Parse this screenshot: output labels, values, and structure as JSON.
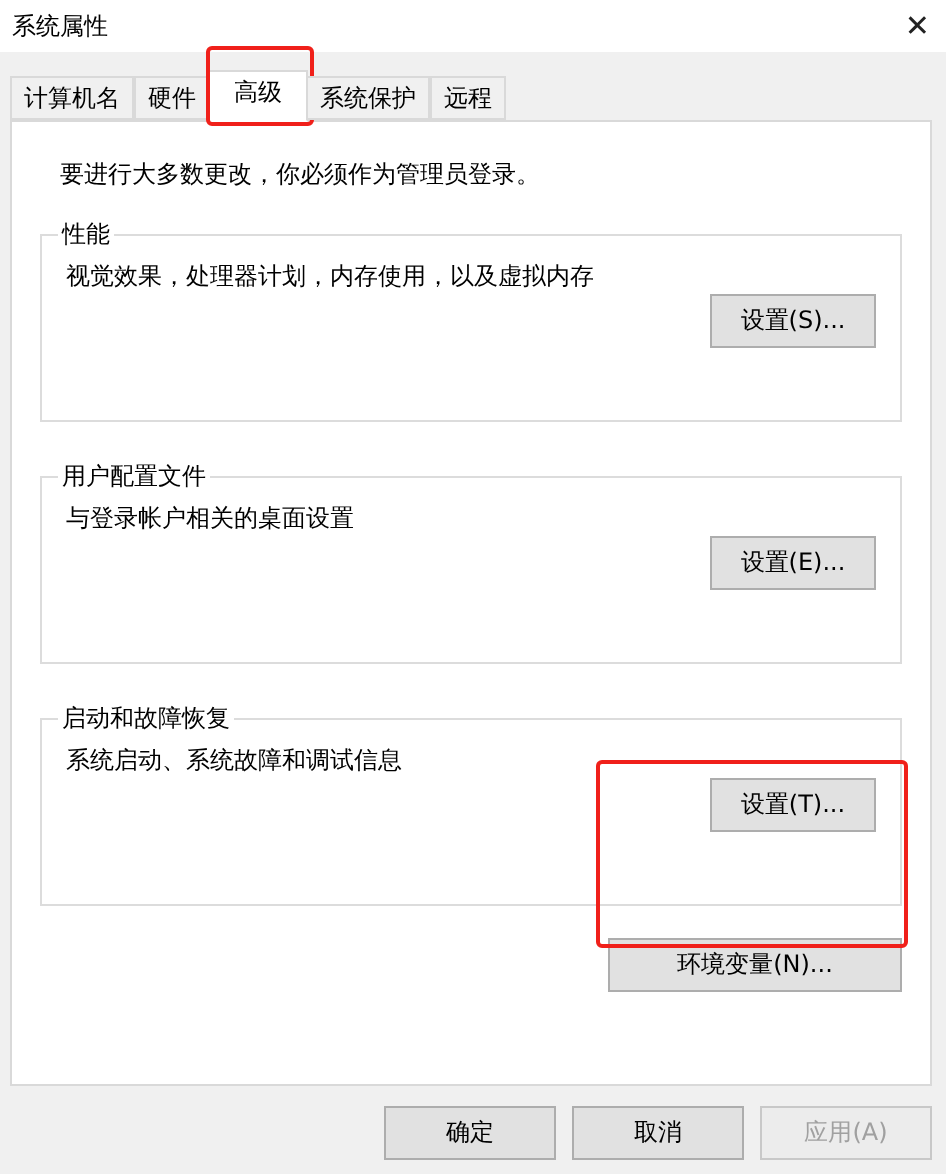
{
  "window": {
    "title": "系统属性",
    "close": "✕"
  },
  "tabs": [
    {
      "label": "计算机名",
      "selected": false,
      "highlighted": false
    },
    {
      "label": "硬件",
      "selected": false,
      "highlighted": false
    },
    {
      "label": "高级",
      "selected": true,
      "highlighted": true
    },
    {
      "label": "系统保护",
      "selected": false,
      "highlighted": false
    },
    {
      "label": "远程",
      "selected": false,
      "highlighted": false
    }
  ],
  "notice": "要进行大多数更改，你必须作为管理员登录。",
  "sections": [
    {
      "title": "性能",
      "description": "视觉效果，处理器计划，内存使用，以及虚拟内存",
      "button": "设置(S)...",
      "highlighted": false
    },
    {
      "title": "用户配置文件",
      "description": "与登录帐户相关的桌面设置",
      "button": "设置(E)...",
      "highlighted": false
    },
    {
      "title": "启动和故障恢复",
      "description": "系统启动、系统故障和调试信息",
      "button": "设置(T)...",
      "highlighted": true
    }
  ],
  "env_button": "环境变量(N)...",
  "buttons": [
    {
      "label": "确定",
      "disabled": false
    },
    {
      "label": "取消",
      "disabled": false
    },
    {
      "label": "应用(A)",
      "disabled": true
    }
  ]
}
